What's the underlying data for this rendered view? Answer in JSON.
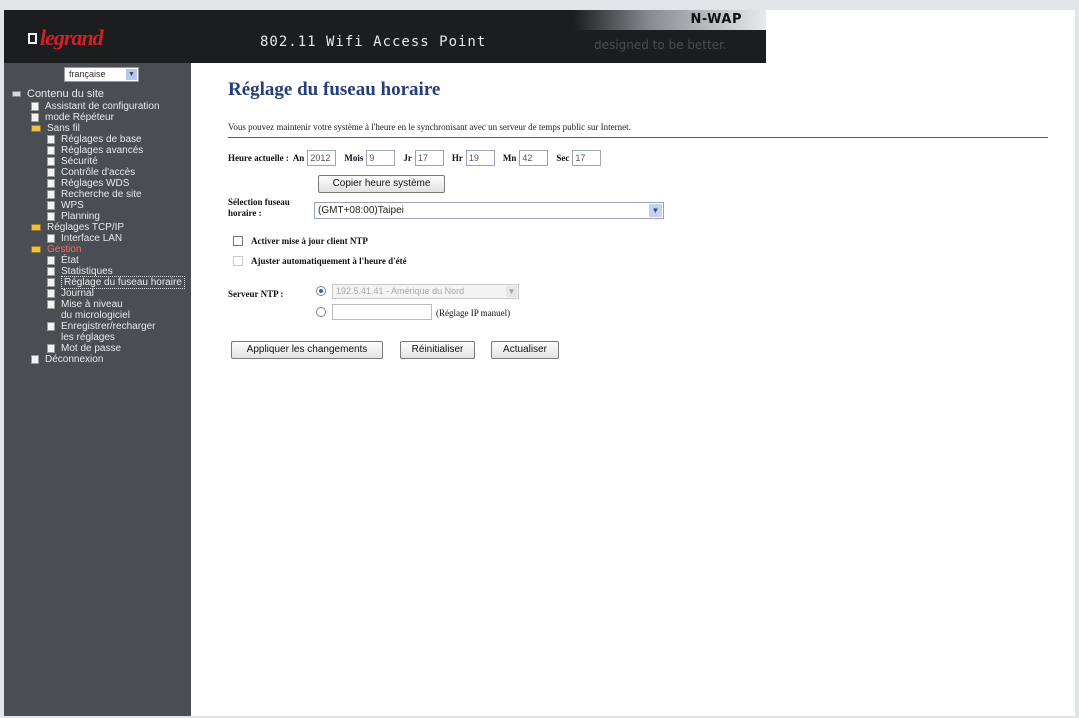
{
  "header": {
    "brand": "legrand",
    "product_title": "802.11 Wifi Access Point",
    "model": "N-WAP",
    "tagline": "designed to be better."
  },
  "sidebar": {
    "language": "française",
    "items": [
      {
        "label": "Contenu du site",
        "icon": "root-folder-icon",
        "level": 0
      },
      {
        "label": "Assistant de configuration",
        "icon": "page-icon",
        "level": 1
      },
      {
        "label": "mode Répéteur",
        "icon": "page-icon",
        "level": 1
      },
      {
        "label": "Sans fil",
        "icon": "folder-icon",
        "level": 1
      },
      {
        "label": "Réglages de base",
        "icon": "page-icon",
        "level": 2
      },
      {
        "label": "Réglages avancés",
        "icon": "page-icon",
        "level": 2
      },
      {
        "label": "Sécurité",
        "icon": "page-icon",
        "level": 2
      },
      {
        "label": "Contrôle d'accès",
        "icon": "page-icon",
        "level": 2
      },
      {
        "label": "Réglages WDS",
        "icon": "page-icon",
        "level": 2
      },
      {
        "label": "Recherche de site",
        "icon": "page-icon",
        "level": 2
      },
      {
        "label": "WPS",
        "icon": "page-icon",
        "level": 2
      },
      {
        "label": "Planning",
        "icon": "page-icon",
        "level": 2
      },
      {
        "label": "Réglages TCP/IP",
        "icon": "folder-icon",
        "level": 1
      },
      {
        "label": "Interface LAN",
        "icon": "page-icon",
        "level": 2
      },
      {
        "label": "Gestion",
        "icon": "folder-icon",
        "level": 1,
        "highlight": "#ff6a6a"
      },
      {
        "label": "État",
        "icon": "page-icon",
        "level": 2
      },
      {
        "label": "Statistiques",
        "icon": "page-icon",
        "level": 2
      },
      {
        "label": "Réglage du fuseau horaire",
        "icon": "page-icon",
        "level": 2,
        "active": true
      },
      {
        "label": "Journal",
        "icon": "page-icon",
        "level": 2
      },
      {
        "label": "Mise à niveau",
        "icon": "page-icon",
        "level": 2
      },
      {
        "label": "du micrologiciel",
        "icon": "",
        "level": 2
      },
      {
        "label": "Enregistrer/recharger",
        "icon": "page-icon",
        "level": 2
      },
      {
        "label": "les réglages",
        "icon": "",
        "level": 2
      },
      {
        "label": "Mot de passe",
        "icon": "page-icon",
        "level": 2
      },
      {
        "label": "Déconnexion",
        "icon": "page-icon",
        "level": 1
      }
    ]
  },
  "main": {
    "title": "Réglage du fuseau horaire",
    "description": "Vous pouvez maintenir votre système à l'heure en le synchronisant avec un serveur de temps public sur Internet.",
    "current_time": {
      "label": "Heure actuelle :",
      "fields": [
        {
          "label": "An",
          "value": "2012"
        },
        {
          "label": "Mois",
          "value": "9"
        },
        {
          "label": "Jr",
          "value": "17"
        },
        {
          "label": "Hr",
          "value": "19"
        },
        {
          "label": "Mn",
          "value": "42"
        },
        {
          "label": "Sec",
          "value": "17"
        }
      ],
      "copy_button": "Copier heure système"
    },
    "timezone": {
      "label_line1": "Sélection fuseau",
      "label_line2": "horaire :",
      "value": "(GMT+08:00)Taipei"
    },
    "ntp_enable_label": "Activer mise à jour client NTP",
    "dst_label": "Ajuster automatiquement à l'heure d'été",
    "ntp_server": {
      "label": "Serveur NTP :",
      "preset_value": "192.5.41.41 - Amérique du Nord",
      "manual_hint": "(Réglage IP manuel)"
    },
    "buttons": {
      "apply": "Appliquer les changements",
      "reset": "Réinitialiser",
      "refresh": "Actualiser"
    }
  }
}
